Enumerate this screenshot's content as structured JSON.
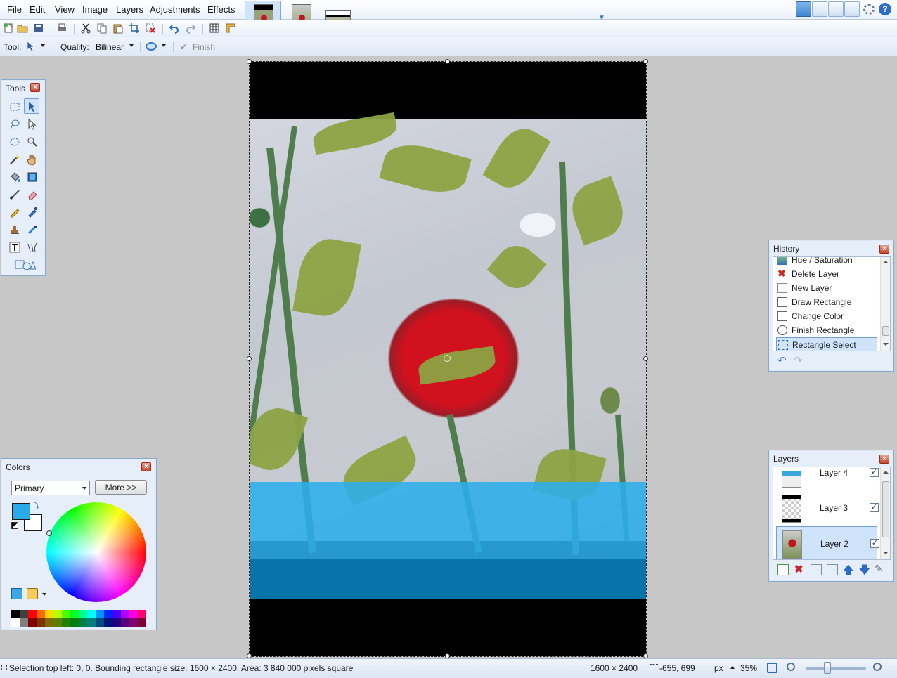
{
  "menu": {
    "items": [
      "File",
      "Edit",
      "View",
      "Image",
      "Layers",
      "Adjustments",
      "Effects"
    ]
  },
  "toolbar2": {
    "tool_label": "Tool:",
    "quality_label": "Quality:",
    "quality_value": "Bilinear",
    "finish_label": "Finish"
  },
  "tools_panel": {
    "title": "Tools"
  },
  "colors_panel": {
    "title": "Colors",
    "mode_value": "Primary",
    "more_button": "More >>",
    "primary_color": "#2ba9e8",
    "secondary_color": "#ffffff"
  },
  "history_panel": {
    "title": "History",
    "items": [
      {
        "label": "Hue / Saturation",
        "icon": "hue-saturation-icon"
      },
      {
        "label": "Delete Layer",
        "icon": "delete-icon"
      },
      {
        "label": "New Layer",
        "icon": "new-layer-icon"
      },
      {
        "label": "Draw Rectangle",
        "icon": "rectangle-icon"
      },
      {
        "label": "Change Color",
        "icon": "color-icon"
      },
      {
        "label": "Finish Rectangle",
        "icon": "finish-icon"
      },
      {
        "label": "Rectangle Select",
        "icon": "rectangle-select-icon"
      }
    ],
    "selected_index": 6
  },
  "layers_panel": {
    "title": "Layers",
    "layers": [
      {
        "name": "Layer 4",
        "visible": true
      },
      {
        "name": "Layer 3",
        "visible": true
      },
      {
        "name": "Layer 2",
        "visible": true
      }
    ],
    "selected": "Layer 2"
  },
  "statusbar": {
    "selection_info": "Selection top left: 0, 0. Bounding rectangle size: 1600 × 2400. Area: 3 840 000 pixels square",
    "image_size": "1600 × 2400",
    "cursor_position": "-655, 699",
    "units": "px",
    "zoom": "35%"
  },
  "colors": {
    "chrome_bg": "#e5eef9",
    "workspace_bg": "#c7c7c7",
    "light_blue_band": "#2caeeb",
    "dark_blue_band": "#0873a8"
  }
}
